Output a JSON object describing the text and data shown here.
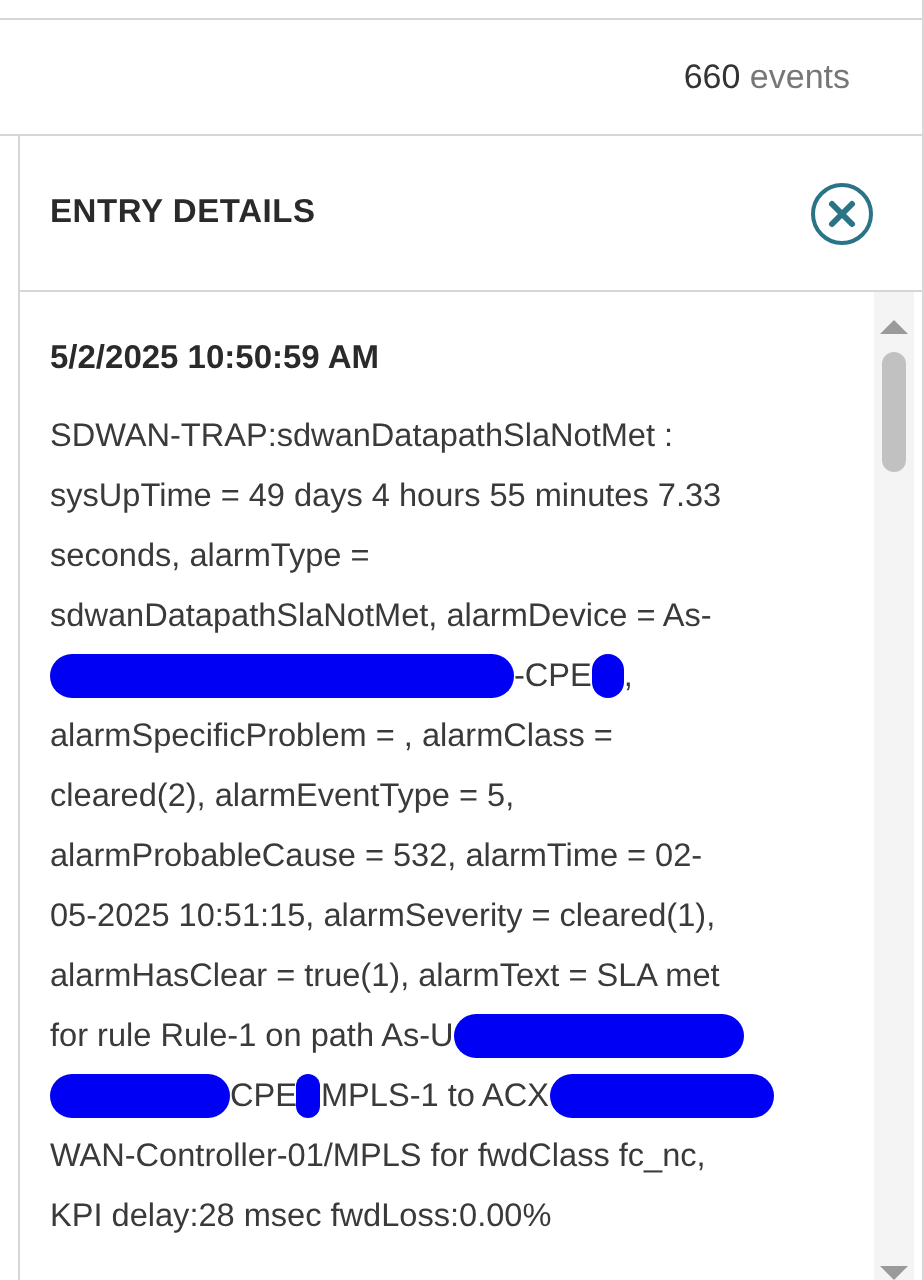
{
  "event_count": {
    "number": "660",
    "unit": "events"
  },
  "entry_details": {
    "title": "ENTRY DETAILS",
    "timestamp": "5/2/2025 10:50:59 AM",
    "message_lines": [
      [
        {
          "kind": "text",
          "text": "SDWAN-TRAP:sdwanDatapathSlaNotMet :"
        }
      ],
      [
        {
          "kind": "text",
          "text": "sysUpTime = 49 days 4 hours 55 minutes 7.33"
        }
      ],
      [
        {
          "kind": "text",
          "text": "seconds, alarmType ="
        }
      ],
      [
        {
          "kind": "text",
          "text": "sdwanDatapathSlaNotMet, alarmDevice = As-"
        }
      ],
      [
        {
          "kind": "redaction"
        },
        {
          "kind": "text",
          "text": "-CPE"
        },
        {
          "kind": "redaction"
        },
        {
          "kind": "text",
          "text": ","
        }
      ],
      [
        {
          "kind": "text",
          "text": "alarmSpecificProblem = , alarmClass ="
        }
      ],
      [
        {
          "kind": "text",
          "text": "cleared(2), alarmEventType = 5,"
        }
      ],
      [
        {
          "kind": "text",
          "text": "alarmProbableCause = 532, alarmTime = 02-"
        }
      ],
      [
        {
          "kind": "text",
          "text": "05-2025 10:51:15, alarmSeverity = cleared(1),"
        }
      ],
      [
        {
          "kind": "text",
          "text": "alarmHasClear = true(1), alarmText = SLA met"
        }
      ],
      [
        {
          "kind": "text",
          "text": "for rule Rule-1 on path As-U"
        },
        {
          "kind": "redaction"
        }
      ],
      [
        {
          "kind": "redaction"
        },
        {
          "kind": "text",
          "text": "CPE"
        },
        {
          "kind": "redaction"
        },
        {
          "kind": "text",
          "text": "MPLS-1 to ACX"
        },
        {
          "kind": "redaction"
        }
      ],
      [
        {
          "kind": "text",
          "text": "WAN-Controller-01/MPLS for fwdClass fc_nc,"
        }
      ],
      [
        {
          "kind": "text",
          "text": "KPI delay:28 msec fwdLoss:0.00%"
        }
      ]
    ]
  }
}
